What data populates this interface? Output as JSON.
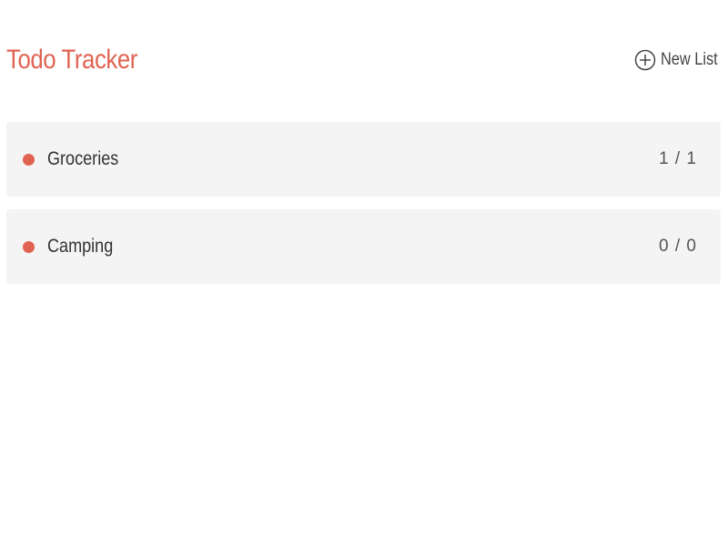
{
  "app": {
    "title": "Todo Tracker",
    "accent_color": "#e06352"
  },
  "header": {
    "new_list_icon": "plus-circle-icon",
    "new_list_label": "New List"
  },
  "lists": [
    {
      "name": "Groceries",
      "count": "1 / 1",
      "dot_color": "#e06352"
    },
    {
      "name": "Camping",
      "count": "0 / 0",
      "dot_color": "#e06352"
    }
  ]
}
